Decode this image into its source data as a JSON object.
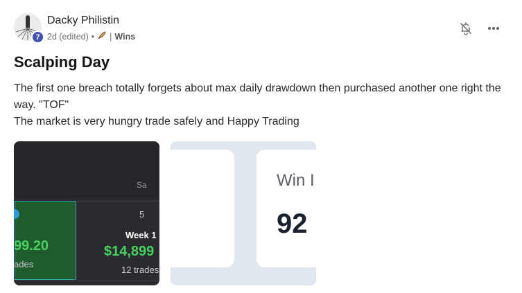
{
  "author": {
    "name": "Dacky Philistin",
    "level": "7",
    "timestamp": "2d (edited)",
    "separator": "•",
    "category_separator": "|",
    "category": "Wins"
  },
  "post": {
    "title": "Scalping Day",
    "body_line1": "The first one breach totally forgets about max daily drawdown then purchased another one right the way. \"TOF\"",
    "body_line2": "The market is very hungry trade safely and Happy Trading"
  },
  "attachments": {
    "calendar": {
      "day_label": "Sa",
      "left_amount": "99.20",
      "left_trades": "ades",
      "day_number": "5",
      "week_label": "Week 1",
      "week_amount": "$14,899",
      "week_trades": "12 trades"
    },
    "stat": {
      "label": "Win I",
      "value": "92"
    }
  },
  "icons": {
    "bell": "bell-off-icon",
    "more": "more-horizontal-icon",
    "category_emoji": "rocket-icon"
  },
  "colors": {
    "level_badge": "#3f51b5",
    "profit_green": "#47d15f",
    "calendar_bg": "#2a2b2f"
  }
}
